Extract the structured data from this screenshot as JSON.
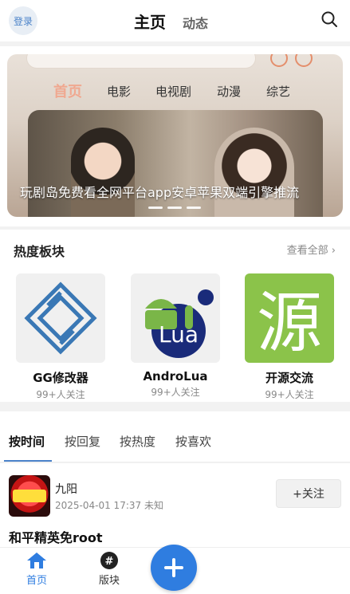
{
  "header": {
    "login_label": "登录",
    "tab_home": "主页",
    "tab_dynamic": "动态"
  },
  "banner": {
    "nav": [
      "首页",
      "电影",
      "电视剧",
      "动漫",
      "综艺"
    ],
    "caption": "玩剧岛免费看全网平台app安卓苹果双端引擎推流"
  },
  "hot": {
    "title": "热度板块",
    "more": "查看全部",
    "items": [
      {
        "name": "GG修改器",
        "followers": "99+人关注"
      },
      {
        "name": "AndroLua",
        "followers": "99+人关注"
      },
      {
        "name": "开源交流",
        "followers": "99+人关注"
      }
    ]
  },
  "sort_tabs": [
    "按时间",
    "按回复",
    "按热度",
    "按喜欢"
  ],
  "post": {
    "user": "九阳",
    "meta": "2025-04-01 17:37 未知",
    "follow": "+关注",
    "title": "和平精英免root"
  },
  "bottom_nav": {
    "home": "首页",
    "section": "版块"
  },
  "colors": {
    "accent": "#2f7de0",
    "login_bg": "#e8eef5",
    "lua_green": "#7ab648",
    "yuan_green": "#8bc34a"
  }
}
